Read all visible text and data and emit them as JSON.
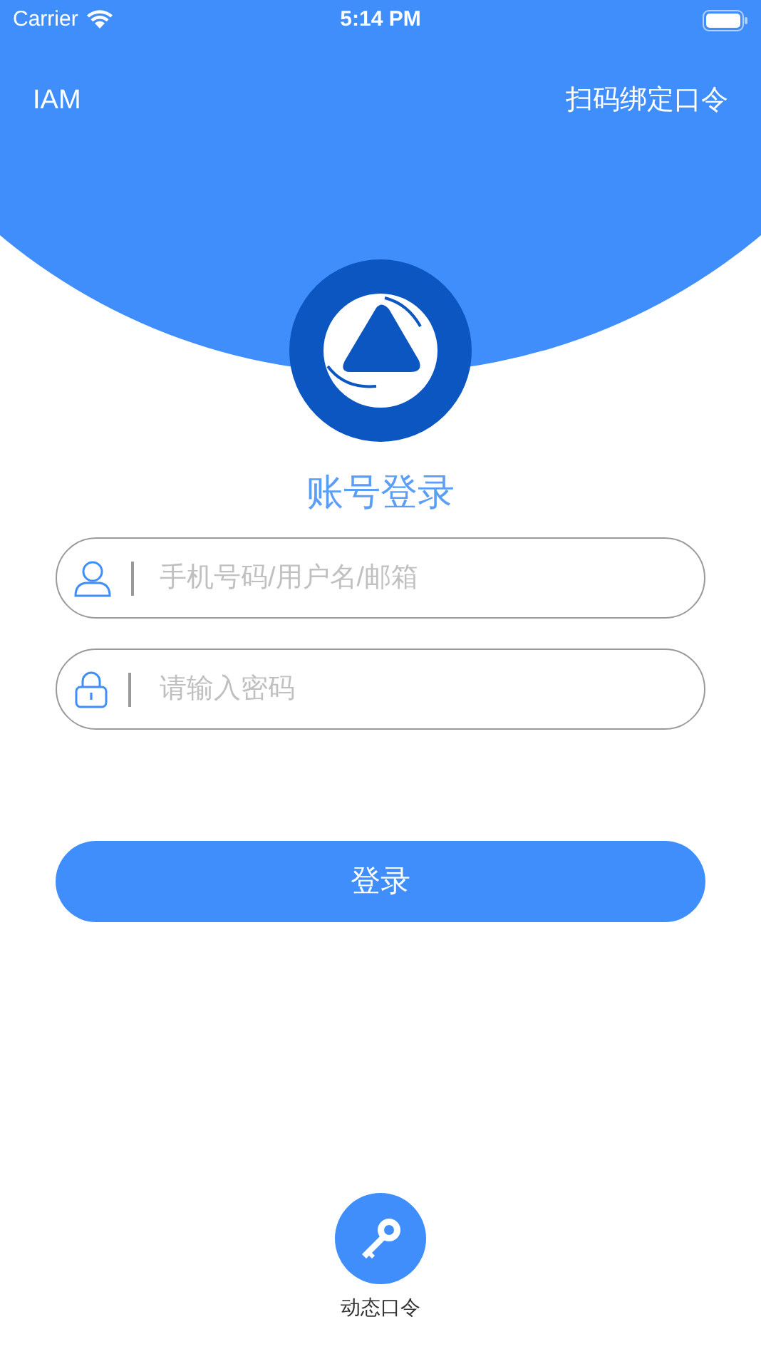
{
  "status_bar": {
    "carrier": "Carrier",
    "time": "5:14 PM"
  },
  "nav": {
    "left": "IAM",
    "right": "扫码绑定口令"
  },
  "title": "账号登录",
  "fields": [
    {
      "kind": "user",
      "placeholder": "手机号码/用户名/邮箱"
    },
    {
      "kind": "password",
      "placeholder": "请输入密码"
    }
  ],
  "login_button": "登录",
  "dynamic_token": {
    "label": "动态口令"
  }
}
